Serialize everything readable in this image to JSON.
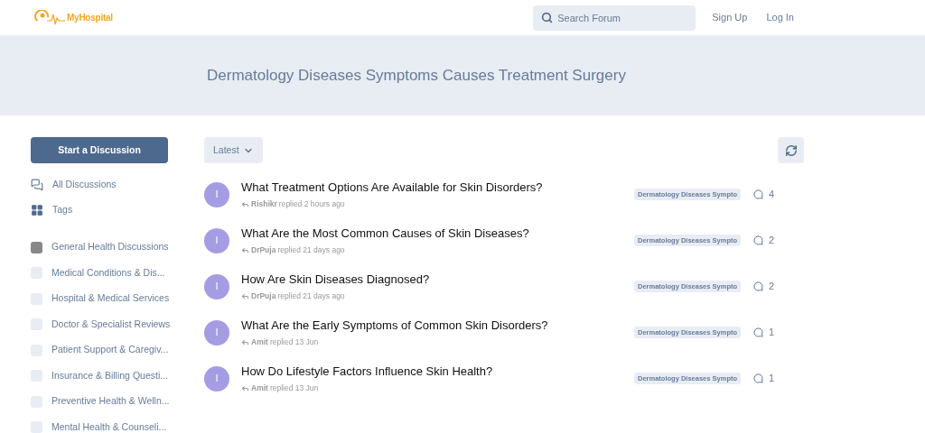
{
  "header": {
    "logo_text": "MyHospital",
    "search": {
      "placeholder": "Search Forum"
    },
    "links": [
      "Sign Up",
      "Log In"
    ]
  },
  "hero": {
    "title": "Dermatology Diseases Symptoms Causes Treatment Surgery"
  },
  "sidebar": {
    "start_button": "Start a Discussion",
    "nav": [
      {
        "label": "All Discussions",
        "kind": "discussions"
      },
      {
        "label": "Tags",
        "kind": "tags"
      }
    ],
    "categories": [
      {
        "label": "General Health Discussions",
        "color": "#888888"
      },
      {
        "label": "Medical Conditions & Dis...",
        "color": "#e8ecf3"
      },
      {
        "label": "Hospital & Medical Services",
        "color": "#e8ecf3"
      },
      {
        "label": "Doctor & Specialist Reviews",
        "color": "#e8ecf3"
      },
      {
        "label": "Patient Support & Caregiv...",
        "color": "#e8ecf3"
      },
      {
        "label": "Insurance & Billing Questi...",
        "color": "#e8ecf3"
      },
      {
        "label": "Preventive Health & Welln...",
        "color": "#e8ecf3"
      },
      {
        "label": "Mental Health & Counseli...",
        "color": "#e8ecf3"
      }
    ]
  },
  "toolbar": {
    "sort": "Latest"
  },
  "discussions": [
    {
      "avatar": "I",
      "title": "What Treatment Options Are Available for Skin Disorders?",
      "user": "Rishikr",
      "action": "replied 2 hours ago",
      "tag": "Dermatology Diseases Sympto",
      "replies": "4"
    },
    {
      "avatar": "I",
      "title": "What Are the Most Common Causes of Skin Diseases?",
      "user": "DrPuja",
      "action": "replied 21 days ago",
      "tag": "Dermatology Diseases Sympto",
      "replies": "2"
    },
    {
      "avatar": "I",
      "title": "How Are Skin Diseases Diagnosed?",
      "user": "DrPuja",
      "action": "replied 21 days ago",
      "tag": "Dermatology Diseases Sympto",
      "replies": "2"
    },
    {
      "avatar": "I",
      "title": "What Are the Early Symptoms of Common Skin Disorders?",
      "user": "Amit",
      "action": "replied 13 Jun",
      "tag": "Dermatology Diseases Sympto",
      "replies": "1"
    },
    {
      "avatar": "I",
      "title": "How Do Lifestyle Factors Influence Skin Health?",
      "user": "Amit",
      "action": "replied 13 Jun",
      "tag": "Dermatology Diseases Sympto",
      "replies": "1"
    }
  ]
}
